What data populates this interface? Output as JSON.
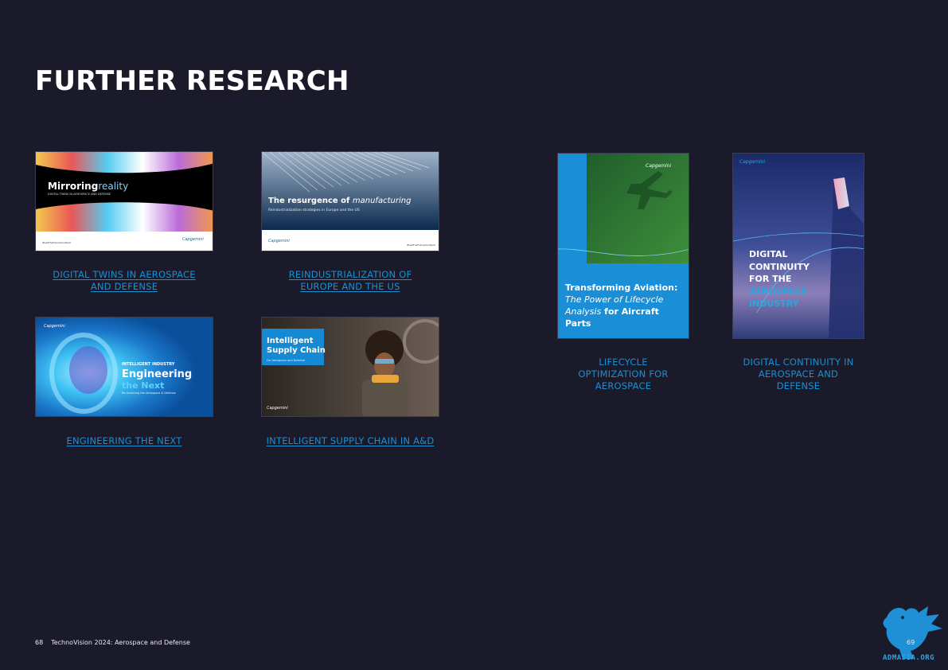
{
  "page": {
    "title": "FURTHER RESEARCH"
  },
  "cards": [
    {
      "link_label_1": "DIGITAL TWINS IN AEROSPACE",
      "link_label_2": "AND DEFENSE",
      "cover_title": "Mirroring",
      "cover_title_accent": "reality",
      "cover_subtitle": "DIGITAL TWINS IN AEROSPACE AND DEFENSE",
      "cover_hashtag": "#GetTheFutureYouWant",
      "cover_brand": "Capgemini"
    },
    {
      "link_label_1": "REINDUSTRIALIZATION OF",
      "link_label_2": "EUROPE AND THE US",
      "cover_title": "The resurgence of",
      "cover_title_accent": "manufacturing",
      "cover_subtitle": "Reindustrialization strategies in Europe and the US",
      "cover_hashtag": "#GetTheFutureYouWant",
      "cover_brand": "Capgemini"
    },
    {
      "link_label_1": "ENGINEERING THE NEXT",
      "cover_kicker": "INTELLIGENT INDUSTRY",
      "cover_title": "Engineering",
      "cover_title_accent": "the Next",
      "cover_subtitle": "Re-inventing the Aerospace & Defense",
      "cover_brand": "Capgemini"
    },
    {
      "link_label_1": "INTELLIGENT SUPPLY CHAIN IN A&D",
      "cover_title_1": "Intelligent",
      "cover_title_2": "Supply Chain",
      "cover_subtitle": "For Aerospace and Defense",
      "cover_brand": "Capgemini"
    },
    {
      "link_label_1": "LIFECYCLE",
      "link_label_2": "OPTIMIZATION FOR",
      "link_label_3": "AEROSPACE",
      "cover_title": "Transforming Aviation:",
      "cover_line_2": "The Power of Lifecycle",
      "cover_line_3a": "Analysis",
      "cover_line_3b": " for Aircraft Parts",
      "cover_brand": "Capgemini"
    },
    {
      "link_label_1": "DIGITAL CONTINUITY IN",
      "link_label_2": "AEROSPACE AND",
      "link_label_3": "DEFENSE",
      "cover_line_1": "DIGITAL",
      "cover_line_2": "CONTINUITY",
      "cover_line_3": "FOR THE",
      "cover_line_4": "AEROSPACE",
      "cover_line_5": "INDUSTRY",
      "cover_brand": "Capgemini"
    }
  ],
  "footer": {
    "left_page_number": "68",
    "publication": "TechnoVision 2024: Aerospace and Defense",
    "right_page_number": "69"
  },
  "watermark": {
    "text": "ADMASIA.ORG"
  },
  "colors": {
    "background": "#1b1a2b",
    "link": "#1a8fd1",
    "accent_blue": "#2aa7e0"
  }
}
